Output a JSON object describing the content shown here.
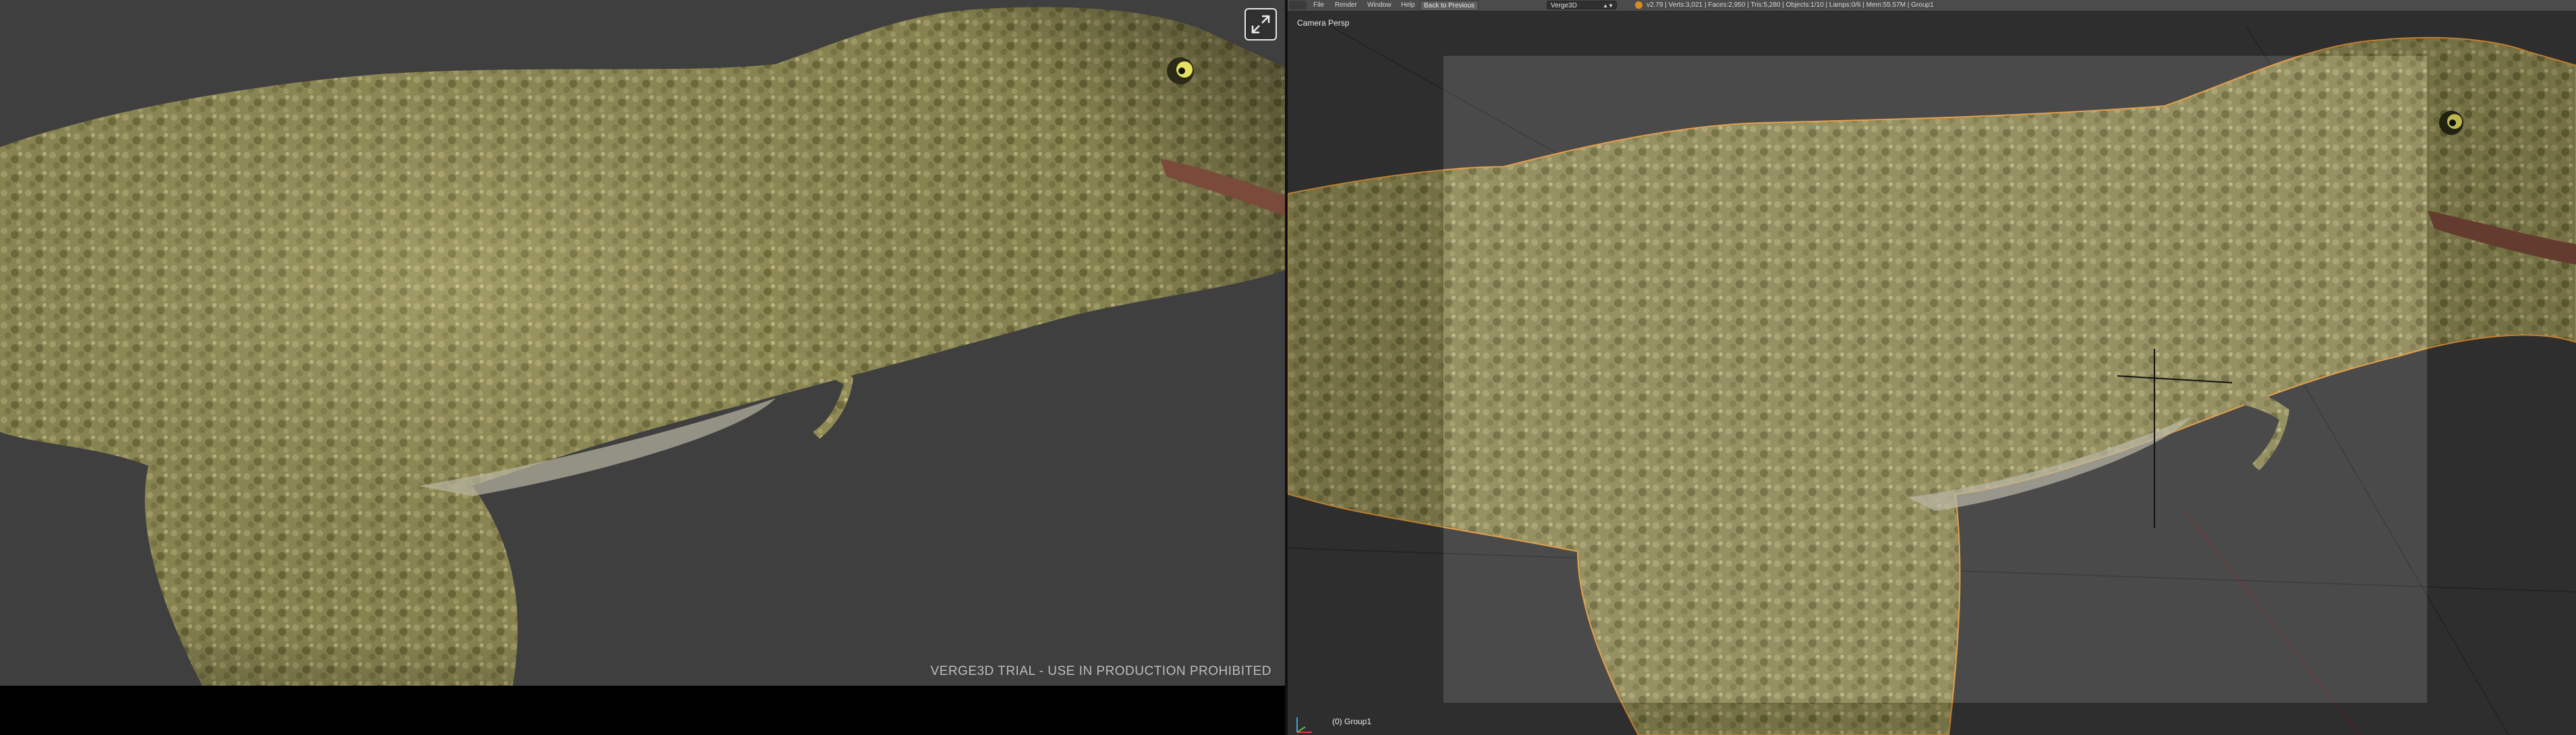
{
  "viewer": {
    "watermark": "VERGE3D TRIAL - USE IN PRODUCTION PROHIBITED",
    "fullscreen_icon": "fullscreen-icon",
    "colors": {
      "background": "#3f3f3f",
      "bottom_bar": "#000000"
    }
  },
  "blender": {
    "menu": [
      "File",
      "Render",
      "Window",
      "Help"
    ],
    "back_button": "Back to Previous",
    "render_engine": "Verge3D",
    "stats": "v2.79 | Verts:3,021 | Faces:2,950 | Tris:5,280 | Objects:1/10 | Lamps:0/6 | Mem:55.57M | Group1",
    "view_label": "Camera Persp",
    "object_label": "(0) Group1",
    "icons": [
      "blender-logo-icon",
      "verge3d-engine-icon",
      "axis-gizmo-icon",
      "cursor-3d-icon"
    ],
    "colors": {
      "selection_outline": "#e89a3c",
      "camera_frame_overlay": "#bdbdbd",
      "header": "#4b4b4b"
    }
  }
}
